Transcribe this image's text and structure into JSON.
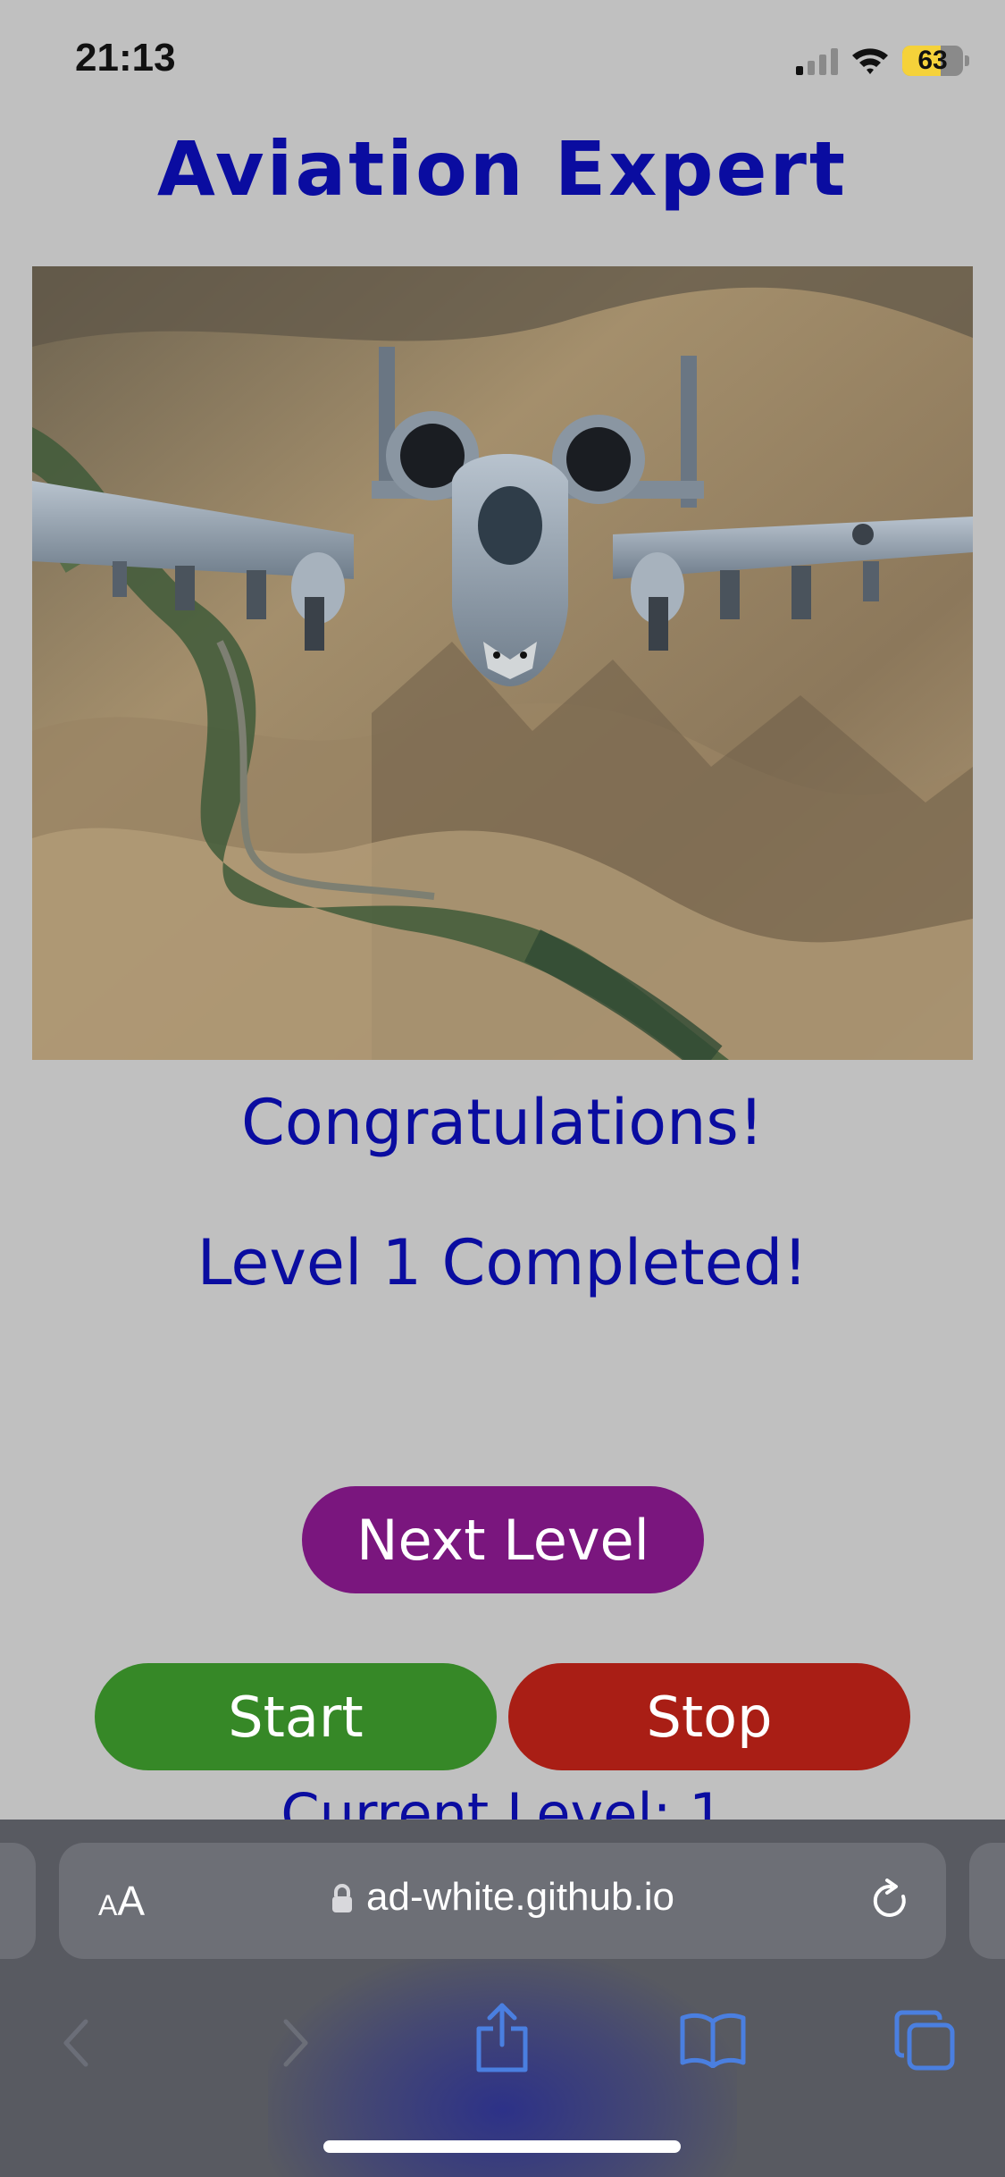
{
  "status_bar": {
    "time": "21:13",
    "battery_percent": "63",
    "battery_level": 0.63,
    "signal_bars_active": 1,
    "icons": [
      "cellular-signal-icon",
      "wifi-icon",
      "battery-icon"
    ]
  },
  "page": {
    "title": "Aviation Expert",
    "hero_image": "a10-warthog-aircraft-over-mountains",
    "message_line1": "Congratulations!",
    "message_line2": "Level 1 Completed!",
    "next_level_label": "Next Level",
    "start_label": "Start",
    "stop_label": "Stop",
    "current_level_text": "Current Level: 1"
  },
  "colors": {
    "background": "#c0c0c0",
    "text_blue": "#0a0ca0",
    "next_button": "#7a167e",
    "start_button": "#368827",
    "stop_button": "#a91e15",
    "toolbar_icon": "#4a7fe0"
  },
  "browser": {
    "text_size_small": "A",
    "text_size_big": "A",
    "url": "ad-white.github.io",
    "icons": [
      "text-size-icon",
      "lock-icon",
      "reload-icon",
      "back-icon",
      "forward-icon",
      "share-icon",
      "bookmarks-icon",
      "tabs-icon"
    ]
  }
}
